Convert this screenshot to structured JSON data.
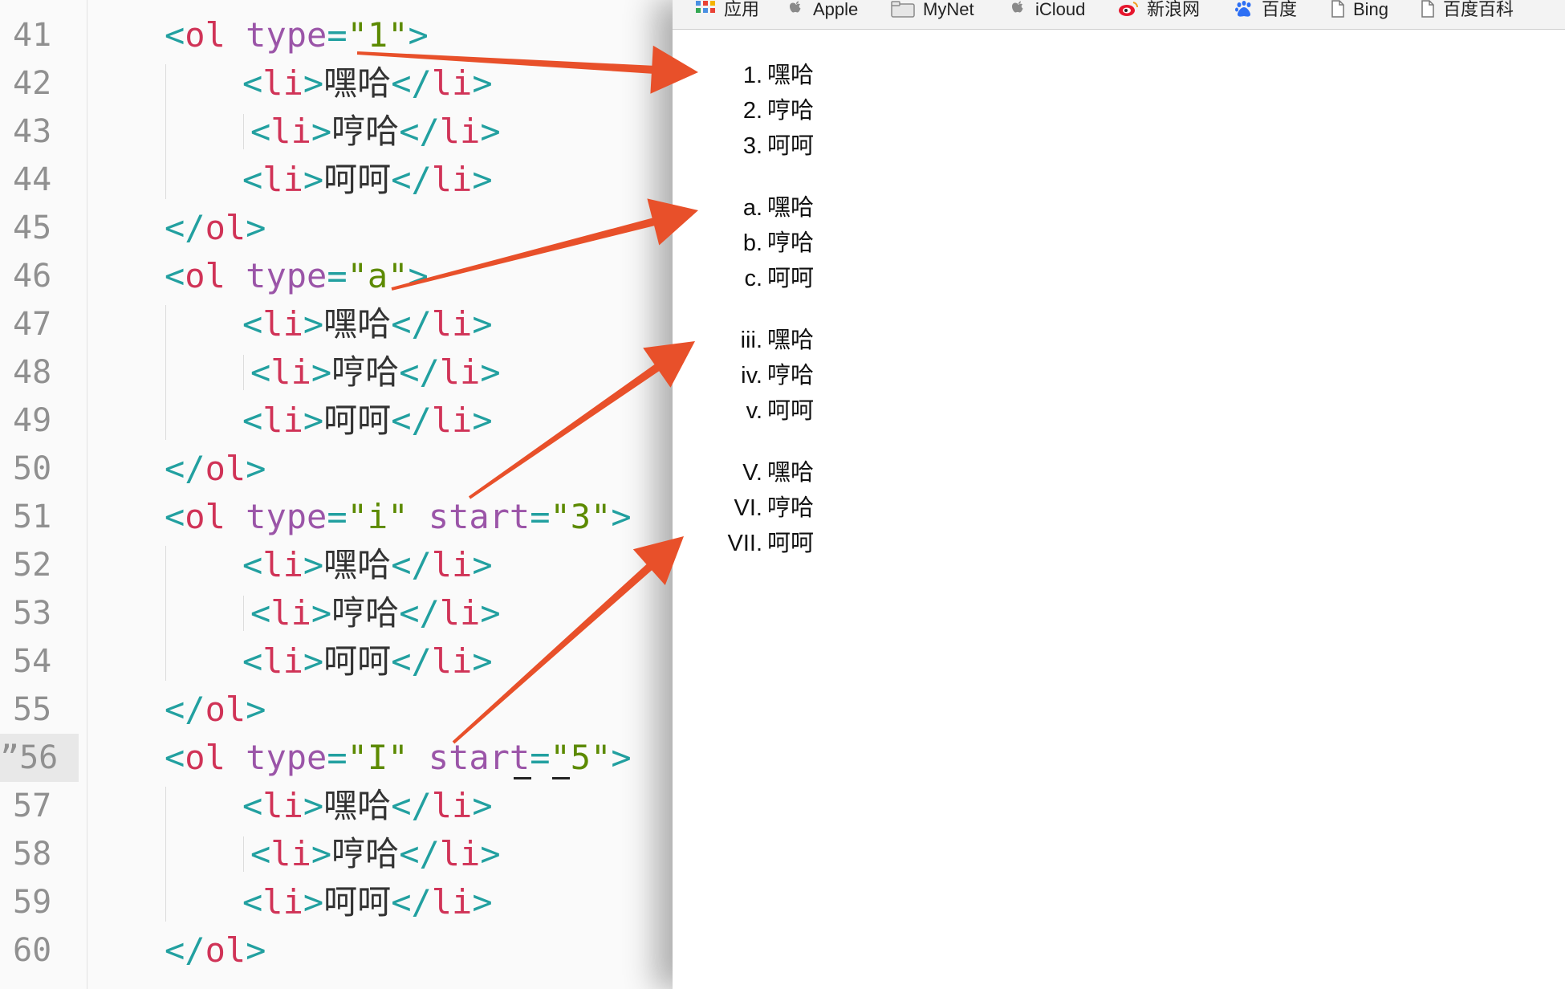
{
  "editor": {
    "lines": [
      {
        "no": "41",
        "parts": [
          [
            "punct",
            "<"
          ],
          [
            "tag",
            "ol"
          ],
          [
            "txt",
            " "
          ],
          [
            "attr",
            "type"
          ],
          [
            "punct",
            "="
          ],
          [
            "str",
            "\"1\""
          ],
          [
            "punct",
            ">"
          ]
        ],
        "indent": 1
      },
      {
        "no": "42",
        "parts": [
          [
            "punct",
            "<"
          ],
          [
            "tag",
            "li"
          ],
          [
            "punct",
            ">"
          ],
          [
            "txt",
            "嘿哈"
          ],
          [
            "punct",
            "</"
          ],
          [
            "tag",
            "li"
          ],
          [
            "punct",
            ">"
          ]
        ],
        "indent": 2
      },
      {
        "no": "43",
        "parts": [
          [
            "punct",
            "<"
          ],
          [
            "tag",
            "li"
          ],
          [
            "punct",
            ">"
          ],
          [
            "txt",
            "哼哈"
          ],
          [
            "punct",
            "</"
          ],
          [
            "tag",
            "li"
          ],
          [
            "punct",
            ">"
          ]
        ],
        "indent": 2.1
      },
      {
        "no": "44",
        "parts": [
          [
            "punct",
            "<"
          ],
          [
            "tag",
            "li"
          ],
          [
            "punct",
            ">"
          ],
          [
            "txt",
            "呵呵"
          ],
          [
            "punct",
            "</"
          ],
          [
            "tag",
            "li"
          ],
          [
            "punct",
            ">"
          ]
        ],
        "indent": 2
      },
      {
        "no": "45",
        "parts": [
          [
            "punct",
            "</"
          ],
          [
            "tag",
            "ol"
          ],
          [
            "punct",
            ">"
          ]
        ],
        "indent": 1
      },
      {
        "no": "46",
        "parts": [
          [
            "punct",
            "<"
          ],
          [
            "tag",
            "ol"
          ],
          [
            "txt",
            " "
          ],
          [
            "attr",
            "type"
          ],
          [
            "punct",
            "="
          ],
          [
            "str",
            "\"a\""
          ],
          [
            "punct",
            ">"
          ]
        ],
        "indent": 1
      },
      {
        "no": "47",
        "parts": [
          [
            "punct",
            "<"
          ],
          [
            "tag",
            "li"
          ],
          [
            "punct",
            ">"
          ],
          [
            "txt",
            "嘿哈"
          ],
          [
            "punct",
            "</"
          ],
          [
            "tag",
            "li"
          ],
          [
            "punct",
            ">"
          ]
        ],
        "indent": 2
      },
      {
        "no": "48",
        "parts": [
          [
            "punct",
            "<"
          ],
          [
            "tag",
            "li"
          ],
          [
            "punct",
            ">"
          ],
          [
            "txt",
            "哼哈"
          ],
          [
            "punct",
            "</"
          ],
          [
            "tag",
            "li"
          ],
          [
            "punct",
            ">"
          ]
        ],
        "indent": 2.1
      },
      {
        "no": "49",
        "parts": [
          [
            "punct",
            "<"
          ],
          [
            "tag",
            "li"
          ],
          [
            "punct",
            ">"
          ],
          [
            "txt",
            "呵呵"
          ],
          [
            "punct",
            "</"
          ],
          [
            "tag",
            "li"
          ],
          [
            "punct",
            ">"
          ]
        ],
        "indent": 2
      },
      {
        "no": "50",
        "parts": [
          [
            "punct",
            "</"
          ],
          [
            "tag",
            "ol"
          ],
          [
            "punct",
            ">"
          ]
        ],
        "indent": 1
      },
      {
        "no": "51",
        "parts": [
          [
            "punct",
            "<"
          ],
          [
            "tag",
            "ol"
          ],
          [
            "txt",
            " "
          ],
          [
            "attr",
            "type"
          ],
          [
            "punct",
            "="
          ],
          [
            "str",
            "\"i\""
          ],
          [
            "txt",
            " "
          ],
          [
            "attr",
            "start"
          ],
          [
            "punct",
            "="
          ],
          [
            "str",
            "\"3\""
          ],
          [
            "punct",
            ">"
          ]
        ],
        "indent": 1
      },
      {
        "no": "52",
        "parts": [
          [
            "punct",
            "<"
          ],
          [
            "tag",
            "li"
          ],
          [
            "punct",
            ">"
          ],
          [
            "txt",
            "嘿哈"
          ],
          [
            "punct",
            "</"
          ],
          [
            "tag",
            "li"
          ],
          [
            "punct",
            ">"
          ]
        ],
        "indent": 2
      },
      {
        "no": "53",
        "parts": [
          [
            "punct",
            "<"
          ],
          [
            "tag",
            "li"
          ],
          [
            "punct",
            ">"
          ],
          [
            "txt",
            "哼哈"
          ],
          [
            "punct",
            "</"
          ],
          [
            "tag",
            "li"
          ],
          [
            "punct",
            ">"
          ]
        ],
        "indent": 2.1
      },
      {
        "no": "54",
        "parts": [
          [
            "punct",
            "<"
          ],
          [
            "tag",
            "li"
          ],
          [
            "punct",
            ">"
          ],
          [
            "txt",
            "呵呵"
          ],
          [
            "punct",
            "</"
          ],
          [
            "tag",
            "li"
          ],
          [
            "punct",
            ">"
          ]
        ],
        "indent": 2
      },
      {
        "no": "55",
        "parts": [
          [
            "punct",
            "</"
          ],
          [
            "tag",
            "ol"
          ],
          [
            "punct",
            ">"
          ]
        ],
        "indent": 1
      },
      {
        "no": "56",
        "parts": [
          [
            "punct",
            "<"
          ],
          [
            "tag",
            "ol"
          ],
          [
            "txt",
            " "
          ],
          [
            "attr",
            "type"
          ],
          [
            "punct",
            "="
          ],
          [
            "str",
            "\"I\""
          ],
          [
            "txt",
            " "
          ],
          [
            "attr",
            "start"
          ],
          [
            "punct",
            "="
          ],
          [
            "str",
            "\"5\""
          ],
          [
            "punct",
            ">"
          ]
        ],
        "indent": 1,
        "active": true
      },
      {
        "no": "57",
        "parts": [
          [
            "punct",
            "<"
          ],
          [
            "tag",
            "li"
          ],
          [
            "punct",
            ">"
          ],
          [
            "txt",
            "嘿哈"
          ],
          [
            "punct",
            "</"
          ],
          [
            "tag",
            "li"
          ],
          [
            "punct",
            ">"
          ]
        ],
        "indent": 2
      },
      {
        "no": "58",
        "parts": [
          [
            "punct",
            "<"
          ],
          [
            "tag",
            "li"
          ],
          [
            "punct",
            ">"
          ],
          [
            "txt",
            "哼哈"
          ],
          [
            "punct",
            "</"
          ],
          [
            "tag",
            "li"
          ],
          [
            "punct",
            ">"
          ]
        ],
        "indent": 2.1
      },
      {
        "no": "59",
        "parts": [
          [
            "punct",
            "<"
          ],
          [
            "tag",
            "li"
          ],
          [
            "punct",
            ">"
          ],
          [
            "txt",
            "呵呵"
          ],
          [
            "punct",
            "</"
          ],
          [
            "tag",
            "li"
          ],
          [
            "punct",
            ">"
          ]
        ],
        "indent": 2
      },
      {
        "no": "60",
        "parts": [
          [
            "punct",
            "</"
          ],
          [
            "tag",
            "ol"
          ],
          [
            "punct",
            ">"
          ]
        ],
        "indent": 1
      }
    ],
    "active_gutter_prefix": "”",
    "colors": {
      "tag": "#d03357",
      "punct": "#22a0a0",
      "attr": "#9b55a8",
      "str": "#5c8a00",
      "arrow": "#e8502a"
    }
  },
  "bookmarks": [
    {
      "label": "应用",
      "icon": "apps-grid-icon"
    },
    {
      "label": "Apple",
      "icon": "apple-icon"
    },
    {
      "label": "MyNet",
      "icon": "folder-icon"
    },
    {
      "label": "iCloud",
      "icon": "apple-icon"
    },
    {
      "label": "新浪网",
      "icon": "weibo-icon"
    },
    {
      "label": "百度",
      "icon": "baidu-paw-icon"
    },
    {
      "label": "Bing",
      "icon": "page-icon"
    },
    {
      "label": "百度百科",
      "icon": "page-icon"
    }
  ],
  "rendered_lists": [
    {
      "items": [
        {
          "marker": "1.",
          "text": "嘿哈"
        },
        {
          "marker": "2.",
          "text": "哼哈"
        },
        {
          "marker": "3.",
          "text": "呵呵"
        }
      ]
    },
    {
      "items": [
        {
          "marker": "a.",
          "text": "嘿哈"
        },
        {
          "marker": "b.",
          "text": "哼哈"
        },
        {
          "marker": "c.",
          "text": "呵呵"
        }
      ]
    },
    {
      "items": [
        {
          "marker": "iii.",
          "text": "嘿哈"
        },
        {
          "marker": "iv.",
          "text": "哼哈"
        },
        {
          "marker": "v.",
          "text": "呵呵"
        }
      ]
    },
    {
      "items": [
        {
          "marker": "V.",
          "text": "嘿哈"
        },
        {
          "marker": "VI.",
          "text": "哼哈"
        },
        {
          "marker": "VII.",
          "text": "呵呵"
        }
      ]
    }
  ]
}
